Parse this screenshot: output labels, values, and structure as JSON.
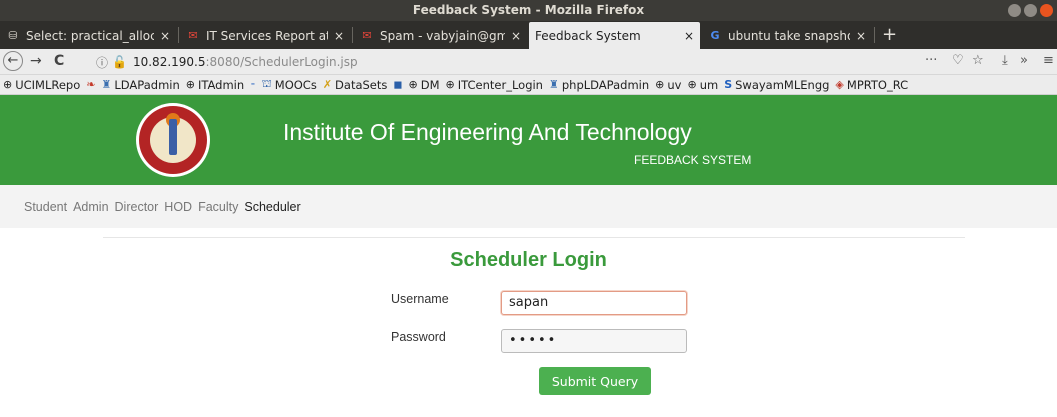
{
  "window": {
    "title": "Feedback System - Mozilla Firefox"
  },
  "tabs": [
    {
      "label": "Select: practical_allocat",
      "icon": "db-icon"
    },
    {
      "label": "IT Services Report at IET",
      "icon": "gmail-icon"
    },
    {
      "label": "Spam - vabyjain@gmail.c",
      "icon": "gmail-icon"
    },
    {
      "label": "Feedback System",
      "icon": "",
      "active": true
    },
    {
      "label": "ubuntu take snapshot - C",
      "icon": "google-icon"
    }
  ],
  "nav": {
    "url_host": "10.82.190.5",
    "url_path": ":8080/SchedulerLogin.jsp",
    "more": "···"
  },
  "bookmarks": [
    {
      "label": "UCIMLRepo",
      "icon": "globe-icon"
    },
    {
      "label": "",
      "icon": "leaf-icon"
    },
    {
      "label": "LDAPadmin",
      "icon": "ldap-icon"
    },
    {
      "label": "ITAdmin",
      "icon": "globe-icon"
    },
    {
      "label": "",
      "icon": "dash-icon"
    },
    {
      "label": "MOOCs",
      "icon": "mooc-icon"
    },
    {
      "label": "DataSets",
      "icon": "dataset-icon"
    },
    {
      "label": "",
      "icon": "square-icon"
    },
    {
      "label": "DM",
      "icon": "globe-icon"
    },
    {
      "label": "ITCenter_Login",
      "icon": "globe-icon"
    },
    {
      "label": "phpLDAPadmin",
      "icon": "ldap-icon"
    },
    {
      "label": "uv",
      "icon": "globe-icon"
    },
    {
      "label": "um",
      "icon": "globe-icon"
    },
    {
      "label": "SwayamMLEngg",
      "icon": "s-icon"
    },
    {
      "label": "MPRTO_RC",
      "icon": "diamond-icon"
    }
  ],
  "site": {
    "title": "Institute Of Engineering And Technology",
    "subtitle": "FEEDBACK SYSTEM",
    "brand_color": "#3a9a3c"
  },
  "menu": {
    "items": [
      "Student",
      "Admin",
      "Director",
      "HOD",
      "Faculty",
      "Scheduler"
    ],
    "active": "Scheduler"
  },
  "login": {
    "title": "Scheduler Login",
    "username_label": "Username",
    "username_value": "sapan",
    "password_label": "Password",
    "password_masked": "•••••",
    "submit_label": "Submit Query",
    "submit_color": "#4cb050"
  }
}
